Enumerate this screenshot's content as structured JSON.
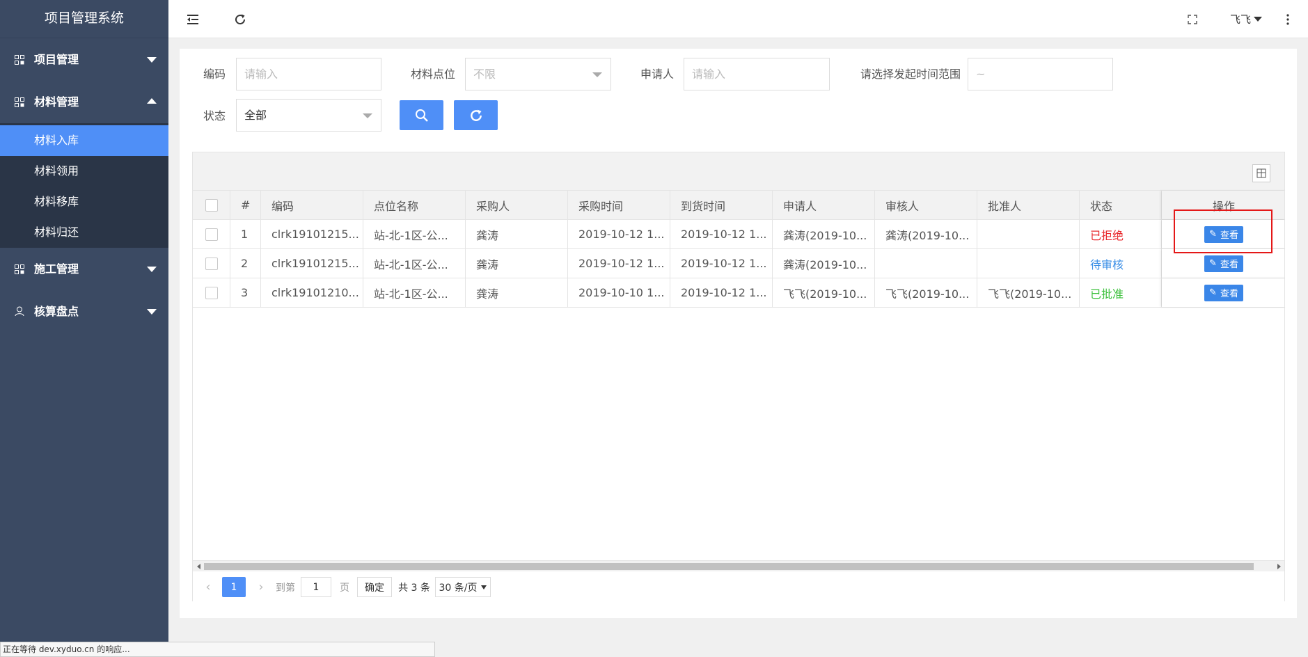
{
  "app": {
    "title": "项目管理系统"
  },
  "sidebar": {
    "groups": [
      {
        "label": "项目管理",
        "expanded": false,
        "icon": "grid-icon"
      },
      {
        "label": "材料管理",
        "expanded": true,
        "icon": "grid-icon",
        "items": [
          {
            "label": "材料入库",
            "active": true
          },
          {
            "label": "材料领用",
            "active": false
          },
          {
            "label": "材料移库",
            "active": false
          },
          {
            "label": "材料归还",
            "active": false
          }
        ]
      },
      {
        "label": "施工管理",
        "expanded": false,
        "icon": "grid-icon"
      },
      {
        "label": "核算盘点",
        "expanded": false,
        "icon": "user-icon"
      }
    ]
  },
  "header": {
    "user_name": "飞飞"
  },
  "filters": {
    "code": {
      "label": "编码",
      "placeholder": "请输入"
    },
    "location": {
      "label": "材料点位",
      "value": "不限"
    },
    "applicant": {
      "label": "申请人",
      "placeholder": "请输入"
    },
    "date_range": {
      "label": "请选择发起时间范围",
      "value": "~"
    },
    "status": {
      "label": "状态",
      "value": "全部"
    }
  },
  "table": {
    "columns": [
      "#",
      "编码",
      "点位名称",
      "采购人",
      "采购时间",
      "到货时间",
      "申请人",
      "审核人",
      "批准人",
      "状态",
      "操作"
    ],
    "rows": [
      {
        "index": "1",
        "code": "clrk19101215...",
        "location": "站-北-1区-公...",
        "buyer": "龚涛",
        "buy_time": "2019-10-12 1...",
        "arrive_time": "2019-10-12 1...",
        "applicant": "龚涛(2019-10...",
        "reviewer": "龚涛(2019-10...",
        "approver": "",
        "status": "已拒绝",
        "status_kind": "rejected",
        "action": "查看"
      },
      {
        "index": "2",
        "code": "clrk19101215...",
        "location": "站-北-1区-公...",
        "buyer": "龚涛",
        "buy_time": "2019-10-12 1...",
        "arrive_time": "2019-10-12 1...",
        "applicant": "龚涛(2019-10...",
        "reviewer": "",
        "approver": "",
        "status": "待审核",
        "status_kind": "pending",
        "action": "查看"
      },
      {
        "index": "3",
        "code": "clrk19101210...",
        "location": "站-北-1区-公...",
        "buyer": "龚涛",
        "buy_time": "2019-10-10 1...",
        "arrive_time": "2019-10-12 1...",
        "applicant": "飞飞(2019-10...",
        "reviewer": "飞飞(2019-10...",
        "approver": "飞飞(2019-10...",
        "status": "已批准",
        "status_kind": "approved",
        "action": "查看"
      }
    ]
  },
  "pagination": {
    "current_page": "1",
    "goto_label": "到第",
    "goto_value": "1",
    "page_unit": "页",
    "confirm_label": "确定",
    "total_label": "共 3 条",
    "page_size_label": "30 条/页"
  },
  "browser_status": "正在等待 dev.xyduo.cn 的响应...",
  "colors": {
    "sidebar_bg": "#3b4a63",
    "accent": "#4f8ff7",
    "rejected": "#e8262a",
    "pending": "#3a8ee6",
    "approved": "#3cc03c"
  }
}
